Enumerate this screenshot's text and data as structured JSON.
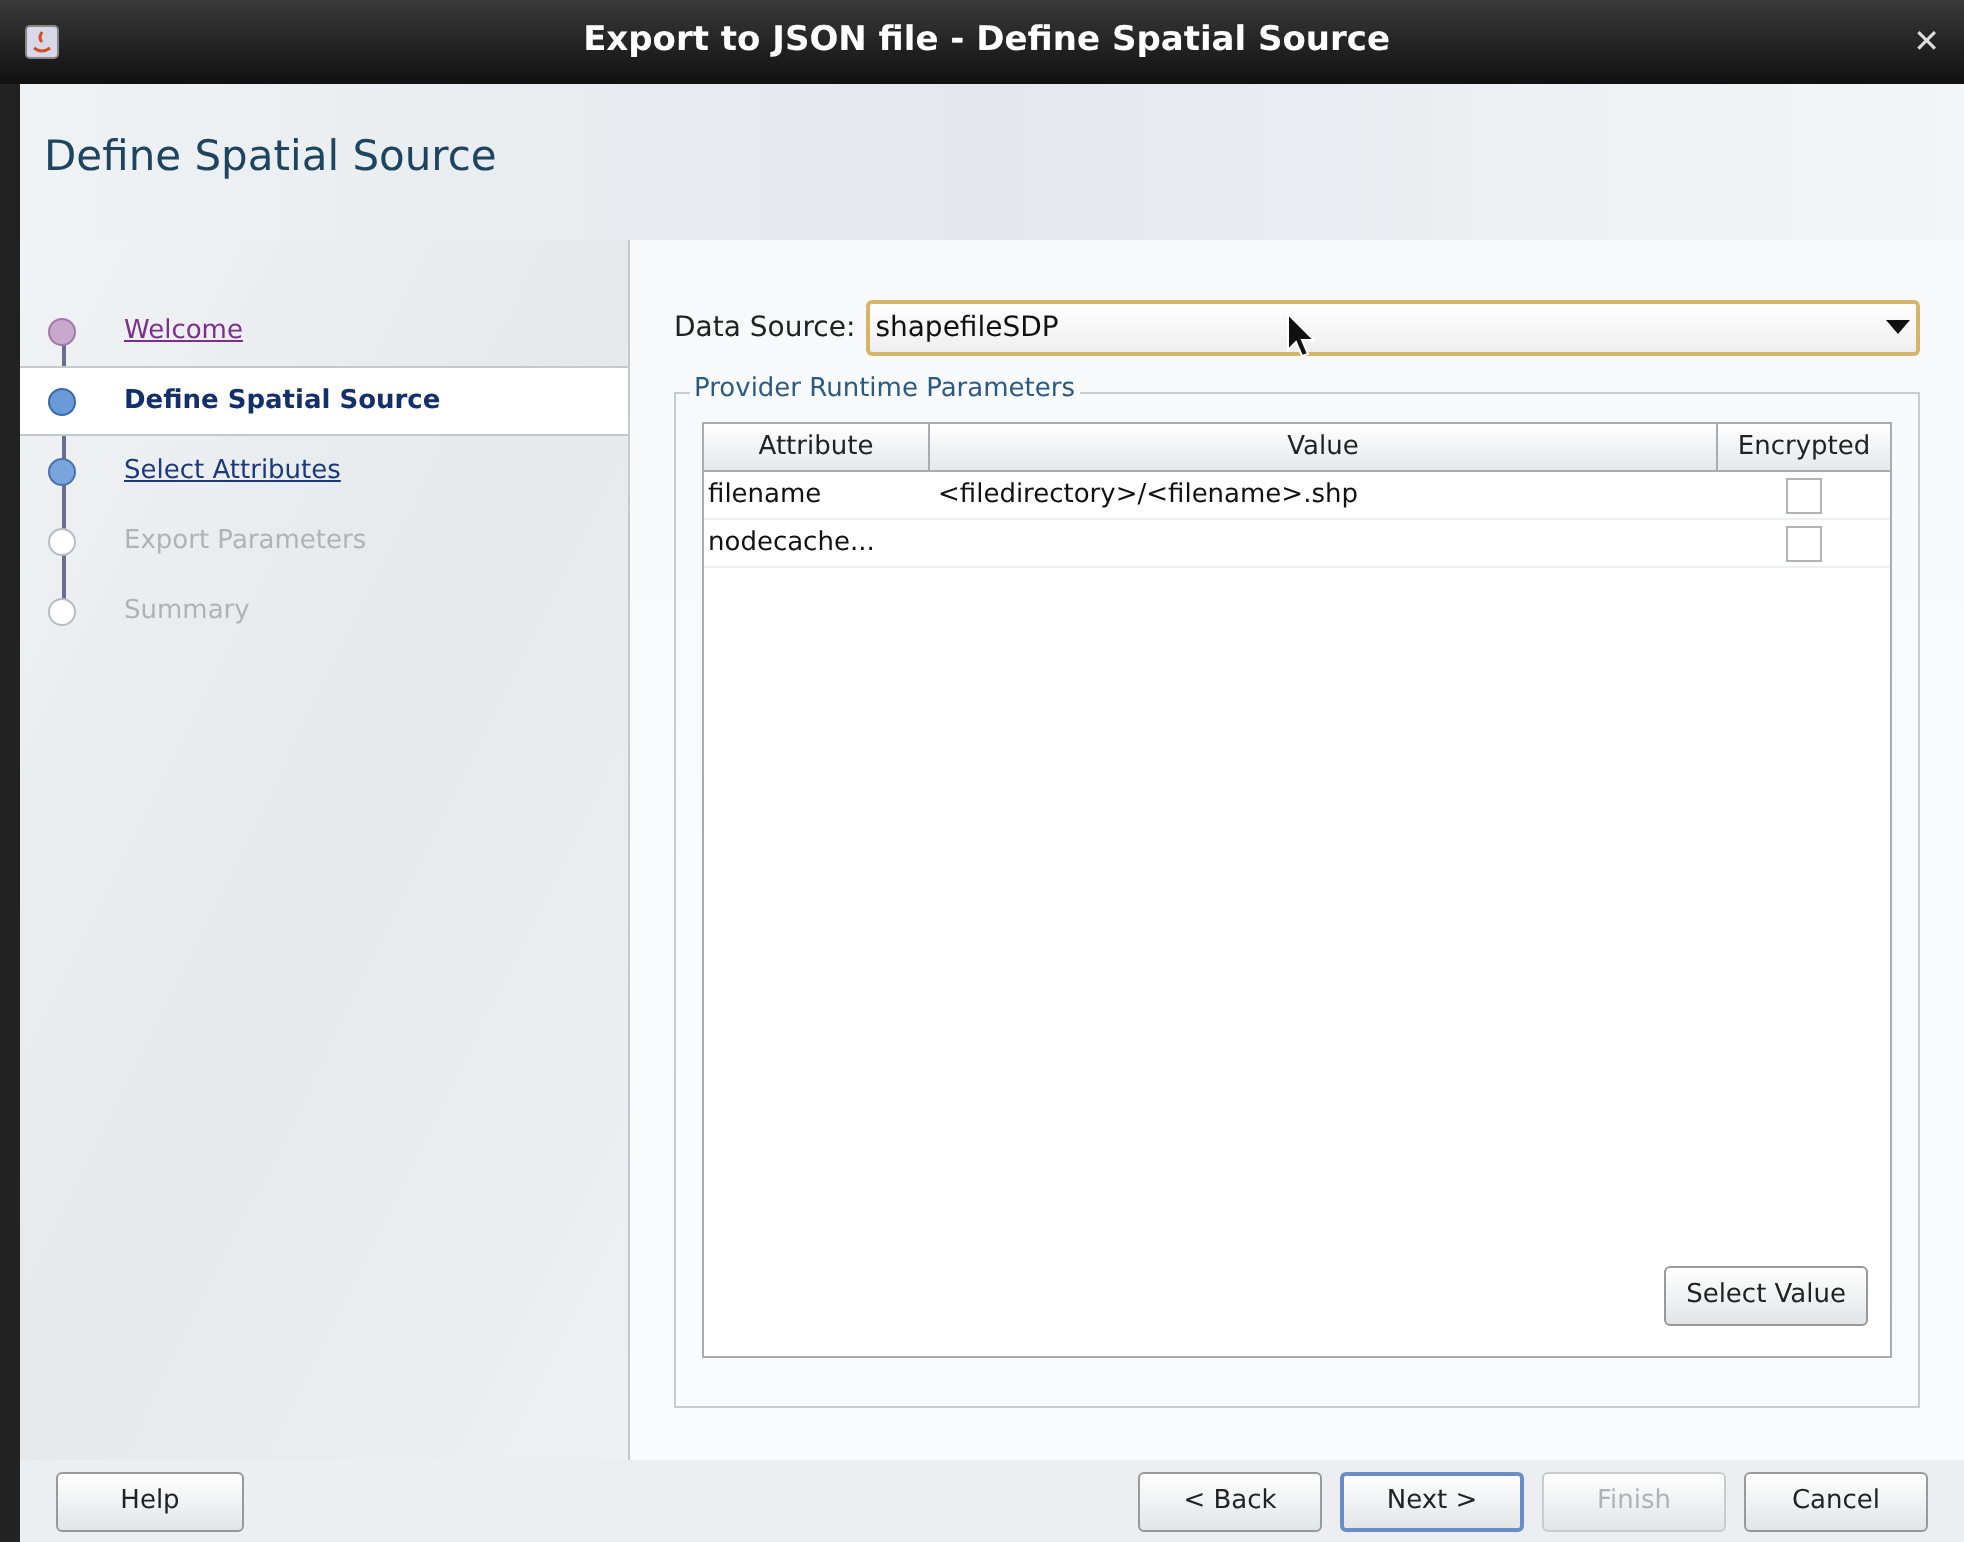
{
  "window": {
    "title": "Export to JSON file - Define Spatial Source",
    "close": "✕"
  },
  "header": {
    "title": "Define Spatial Source"
  },
  "steps": [
    {
      "label": "Welcome",
      "visited": true,
      "disabled": false,
      "selected": false
    },
    {
      "label": "Define Spatial Source",
      "visited": false,
      "disabled": false,
      "selected": true
    },
    {
      "label": "Select Attributes",
      "visited": false,
      "disabled": false,
      "selected": false
    },
    {
      "label": "Export Parameters",
      "visited": false,
      "disabled": true,
      "selected": false
    },
    {
      "label": "Summary",
      "visited": false,
      "disabled": true,
      "selected": false
    }
  ],
  "data_source": {
    "label": "Data Source:",
    "value": "shapefileSDP"
  },
  "parameters": {
    "title": "Provider Runtime Parameters",
    "columns": [
      "Attribute",
      "Value",
      "Encrypted"
    ],
    "rows": [
      {
        "attribute": "filename",
        "value": "<filedirectory>/<filename>.shp",
        "encrypted": false
      },
      {
        "attribute": "nodecache...",
        "encrypted": false
      }
    ],
    "select_button": "Select Value"
  },
  "buttons": [
    {
      "label": "Help",
      "kind": "left",
      "disabled": false,
      "default": false
    },
    {
      "label": "< Back",
      "kind": "right",
      "disabled": false,
      "default": false
    },
    {
      "label": "Next >",
      "kind": "right",
      "disabled": false,
      "default": true
    },
    {
      "label": "Finish",
      "kind": "right",
      "disabled": true,
      "default": false
    },
    {
      "label": "Cancel",
      "kind": "right",
      "disabled": false,
      "default": false
    }
  ]
}
